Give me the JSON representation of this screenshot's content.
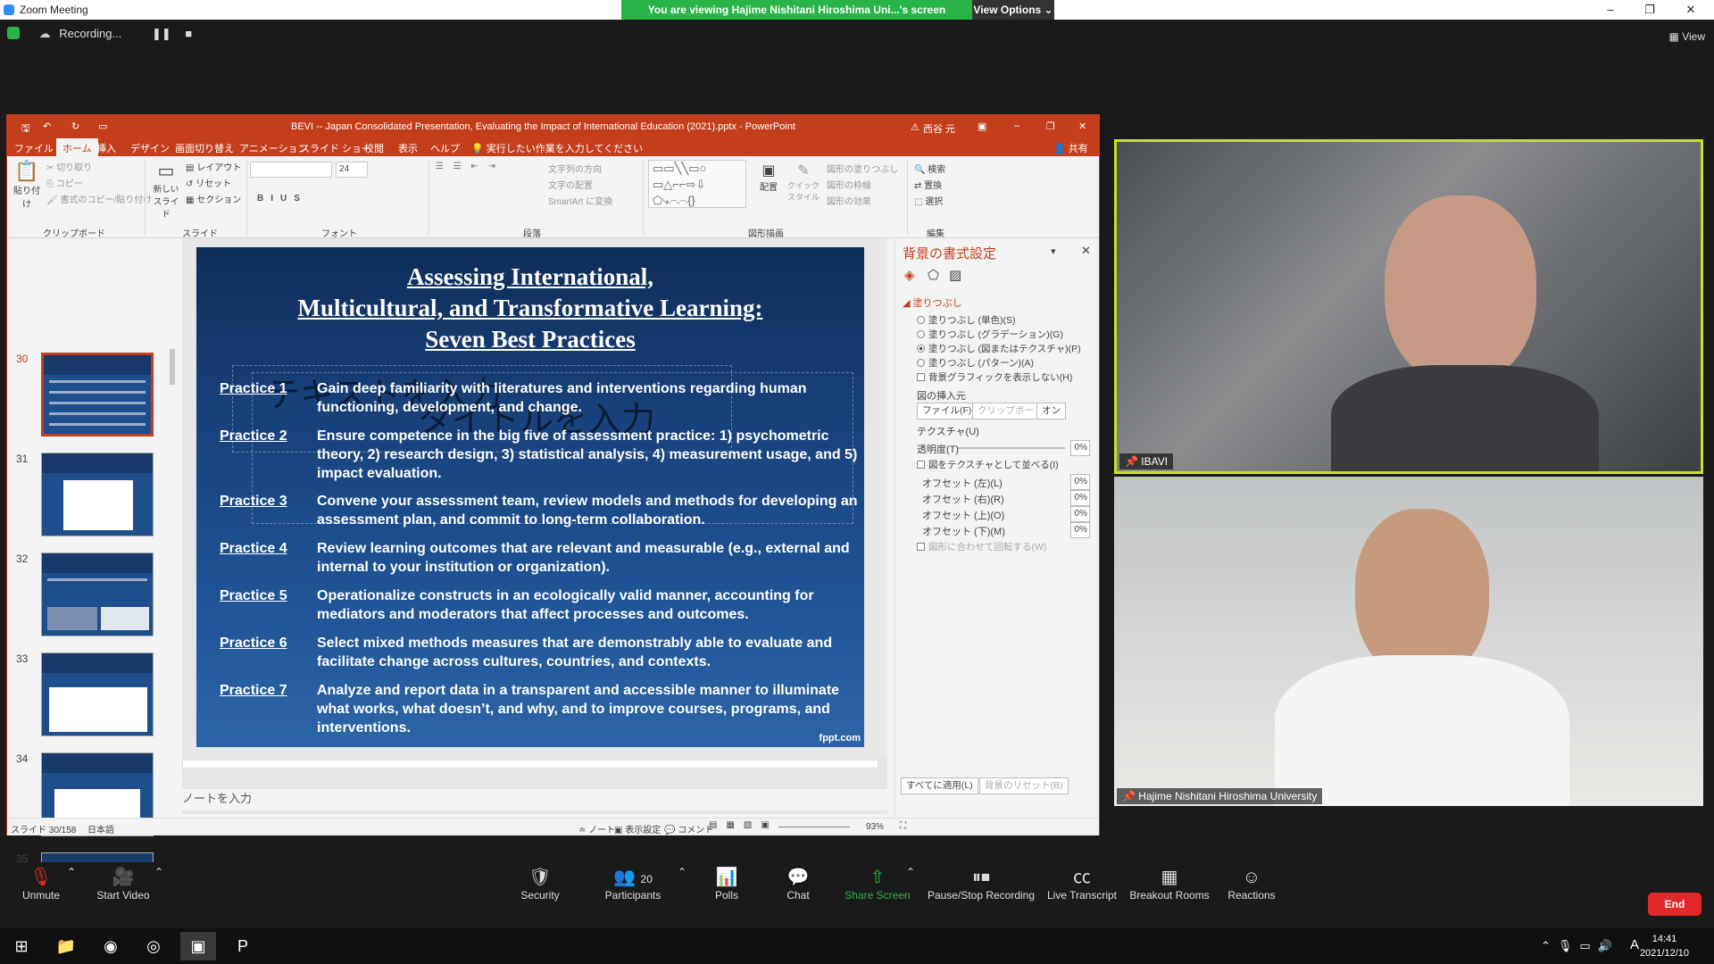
{
  "zoom": {
    "window_title": "Zoom Meeting",
    "share_banner": "You are viewing Hajime Nishitani Hiroshima Uni...'s screen",
    "view_options": "View Options",
    "recording": "Recording...",
    "view_label": "View",
    "participants_count": "20",
    "end_label": "End",
    "toolbar": {
      "unmute": "Unmute",
      "start_video": "Start Video",
      "security": "Security",
      "participants": "Participants",
      "polls": "Polls",
      "chat": "Chat",
      "share_screen": "Share Screen",
      "pause_stop": "Pause/Stop Recording",
      "live_transcript": "Live Transcript",
      "breakout": "Breakout Rooms",
      "reactions": "Reactions"
    },
    "video1_name": "IBAVI",
    "video2_name": "Hajime Nishitani Hiroshima University"
  },
  "ppt": {
    "title": "BEVI -- Japan Consolidated Presentation, Evaluating the Impact of International Education (2021).pptx  -  PowerPoint",
    "user": "西谷 元",
    "share": "共有",
    "tabs": [
      "ファイル",
      "ホーム",
      "挿入",
      "デザイン",
      "画面切り替え",
      "アニメーション",
      "スライド ショー",
      "校閲",
      "表示",
      "ヘルプ"
    ],
    "tell_me": "実行したい作業を入力してください",
    "ribbon": {
      "paste": "貼り付け",
      "cut": "切り取り",
      "copy": "コピー",
      "format_painter": "書式のコピー/貼り付け",
      "clipboard": "クリップボード",
      "new_slide": "新しいスライド",
      "layout": "レイアウト",
      "reset": "リセット",
      "section": "セクション",
      "slides": "スライド",
      "font_size": "24",
      "font": "フォント",
      "text_direction": "文字列の方向",
      "align_text": "文字の配置",
      "smartart": "SmartArt に変換",
      "paragraph": "段落",
      "arrange": "配置",
      "quick_styles": "クイック スタイル",
      "shape_fill": "図形の塗りつぶし",
      "shape_outline": "図形の枠線",
      "shape_effects": "図形の効果",
      "drawing": "図形描画",
      "find": "検索",
      "replace": "置換",
      "select": "選択",
      "editing": "編集"
    },
    "thumb_numbers": [
      "30",
      "31",
      "32",
      "33",
      "34",
      "35"
    ],
    "slide": {
      "title_lines": [
        "Assessing International,",
        "Multicultural, and Transformative Learning:",
        "Seven Best Practices"
      ],
      "practices": [
        {
          "label": "Practice 1",
          "text": "Gain deep familiarity with literatures and interventions regarding human functioning, development, and change."
        },
        {
          "label": "Practice 2",
          "text": "Ensure competence in the big five of assessment practice: 1) psychometric theory, 2) research design, 3) statistical analysis, 4) measurement usage, and 5) impact evaluation."
        },
        {
          "label": "Practice 3",
          "text": "Convene your assessment team, review models and methods for developing an assessment plan, and commit to long-term collaboration."
        },
        {
          "label": "Practice 4",
          "text": "Review learning outcomes that are relevant and measurable (e.g., external and internal to your institution or organization)."
        },
        {
          "label": "Practice 5",
          "text": "Operationalize constructs in an ecologically valid manner, accounting for mediators and moderators that affect processes and outcomes."
        },
        {
          "label": "Practice 6",
          "text": "Select mixed methods measures that are demonstrably able to evaluate and facilitate change across cultures, countries, and contexts."
        },
        {
          "label": "Practice 7",
          "text": "Analyze and report data in a transparent and accessible manner to illuminate what works, what doesn’t, and why, and to improve courses, programs, and interventions."
        }
      ],
      "ghost_text1": "テキストを入力",
      "ghost_text2": "タイトルを入力",
      "watermark": "fppt.com"
    },
    "format_pane": {
      "title": "背景の書式設定",
      "fill_section": "塗りつぶし",
      "options": [
        "塗りつぶし (単色)(S)",
        "塗りつぶし (グラデーション)(G)",
        "塗りつぶし (図またはテクスチャ)(P)",
        "塗りつぶし (パターン)(A)"
      ],
      "hide_bg": "背景グラフィックを表示しない(H)",
      "insert_picture": "図の挿入元",
      "file_btn": "ファイル(F)...",
      "clipboard_btn": "クリップボード(C)",
      "online_btn": "オン",
      "texture": "テクスチャ(U)",
      "transparency": "透明度(T)",
      "tile": "図をテクスチャとして並べる(I)",
      "offsets": [
        "オフセット (左)(L)",
        "オフセット (右)(R)",
        "オフセット (上)(O)",
        "オフセット (下)(M)"
      ],
      "pct": "0%",
      "rotate": "図形に合わせて回転する(W)",
      "apply_all": "すべてに適用(L)",
      "reset_bg": "背景のリセット(B)"
    },
    "notes_placeholder": "ノートを入力",
    "status": {
      "slide_of": "スライド 30/158",
      "language": "日本語",
      "notes": "ノート",
      "display": "表示設定",
      "comments": "コメント",
      "zoom": "93%"
    }
  },
  "taskbar": {
    "time": "14:41",
    "date": "2021/12/10",
    "ime": "A"
  }
}
